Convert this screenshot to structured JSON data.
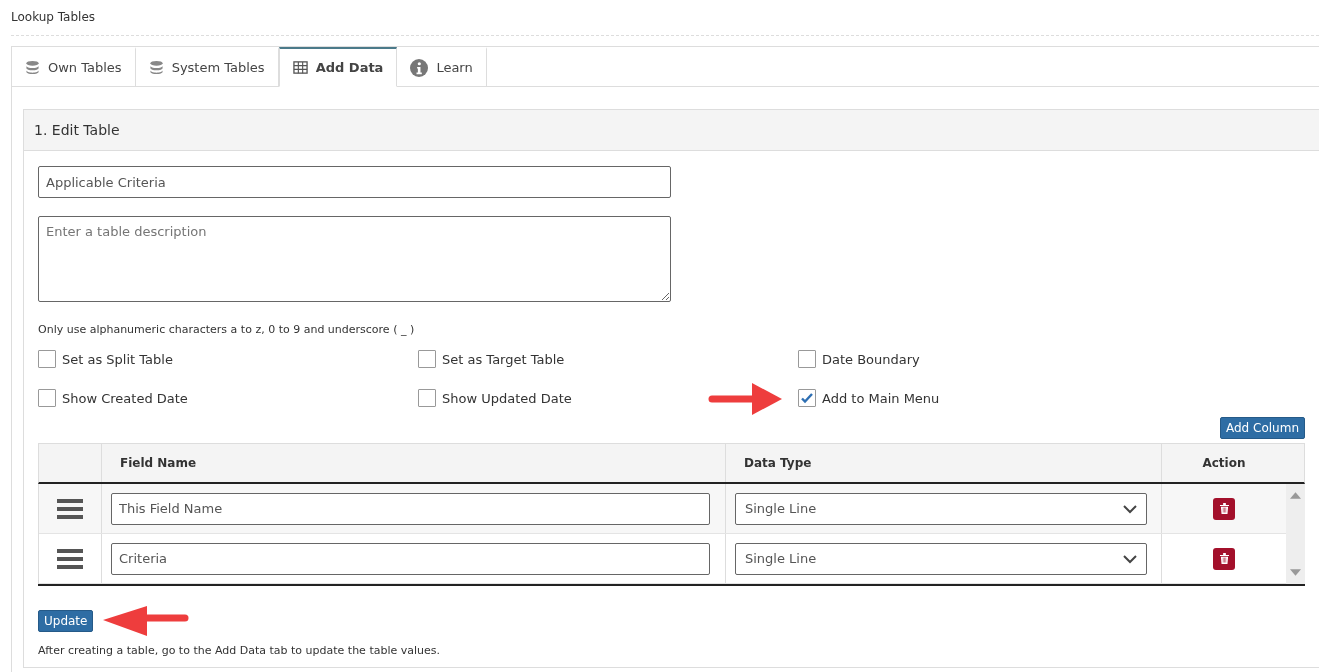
{
  "page_title": "Lookup Tables",
  "tabs": [
    {
      "label": "Own Tables",
      "selected": false
    },
    {
      "label": "System Tables",
      "selected": false
    },
    {
      "label": "Add Data",
      "selected": true
    },
    {
      "label": "Learn",
      "selected": false
    }
  ],
  "section": {
    "title": "1. Edit Table",
    "name_field": {
      "value": "Applicable Criteria"
    },
    "description_field": {
      "placeholder": "Enter a table description"
    },
    "hint": "Only use alphanumeric characters a to z, 0 to 9 and underscore ( _ )",
    "options": [
      {
        "label": "Set as Split Table",
        "checked": false
      },
      {
        "label": "Set as Target Table",
        "checked": false
      },
      {
        "label": "Date Boundary",
        "checked": false
      },
      {
        "label": "Show Created Date",
        "checked": false
      },
      {
        "label": "Show Updated Date",
        "checked": false
      },
      {
        "label": "Add to Main Menu",
        "checked": true,
        "annotated": true
      }
    ],
    "add_column_button": "Add Column",
    "table": {
      "columns": [
        "Field Name",
        "Data Type",
        "Action"
      ],
      "rows": [
        {
          "field_name": "This Field Name",
          "data_type": "Single Line"
        },
        {
          "field_name": "Criteria",
          "data_type": "Single Line"
        }
      ]
    },
    "update_button": {
      "label": "Update",
      "annotated": true
    },
    "footer_note": "After creating a table, go to the Add Data tab to update the table values."
  }
}
